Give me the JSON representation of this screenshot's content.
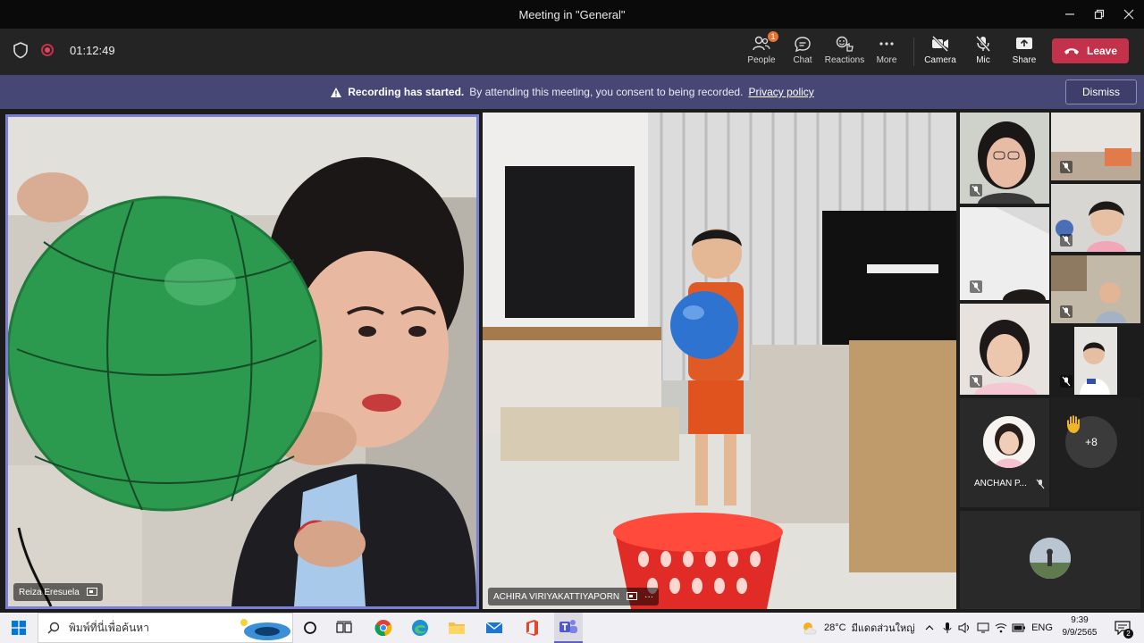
{
  "window": {
    "title": "Meeting in \"General\""
  },
  "toolbar": {
    "timer": "01:12:49",
    "people_label": "People",
    "people_badge": "1",
    "chat_label": "Chat",
    "reactions_label": "Reactions",
    "more_label": "More",
    "camera_label": "Camera",
    "mic_label": "Mic",
    "share_label": "Share",
    "leave_label": "Leave"
  },
  "banner": {
    "heading": "Recording has started.",
    "message": "By attending this meeting, you consent to being recorded.",
    "link": "Privacy policy",
    "dismiss_label": "Dismiss"
  },
  "participants": {
    "main": {
      "name": "Reiza Eresuela"
    },
    "second": {
      "name": "ACHIRA VIRIYAKATTIYAPORN",
      "more": "···"
    },
    "card": {
      "name": "ANCHAN P..."
    },
    "overflow": {
      "count": "+8"
    }
  },
  "taskbar": {
    "search_placeholder": "พิมพ์ที่นี่เพื่อค้นหา",
    "weather_temp": "28°C",
    "weather_text": "มีแดดส่วนใหญ่",
    "language": "ENG",
    "time": "9:39",
    "date": "9/9/2565",
    "notification_count": "2"
  },
  "colors": {
    "leave": "#c4314b",
    "banner": "#464775",
    "active_border": "#7b7fd4",
    "raised_hand": "#f0b429"
  }
}
